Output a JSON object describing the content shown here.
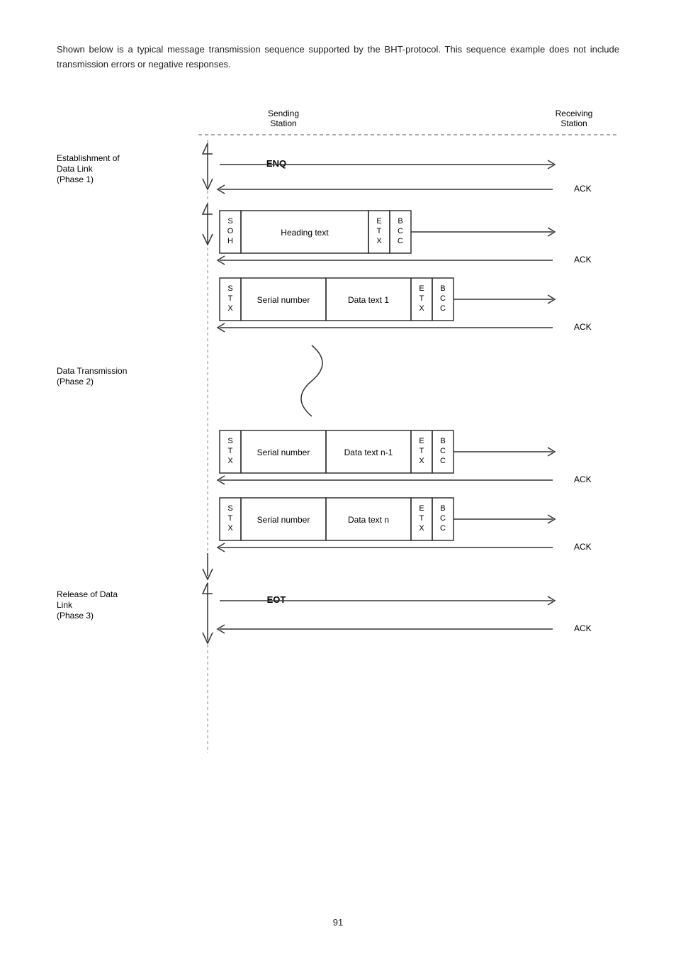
{
  "intro": {
    "text": "Shown below is a typical message transmission sequence supported by the BHT-protocol.  This sequence example does not include transmission errors or negative responses."
  },
  "diagram": {
    "sending_station": "Sending\nStation",
    "receiving_station": "Receiving\nStation",
    "phase1_label": "Establishment of\nData Link\n(Phase 1)",
    "phase2_label": "Data Transmission\n(Phase 2)",
    "phase3_label": "Release of Data\nLink\n(Phase 3)",
    "enq": "ENQ",
    "eot": "EOT",
    "ack": "ACK",
    "heading_text": "Heading text",
    "serial_number": "Serial number",
    "data_text_1": "Data text 1",
    "data_text_n1": "Data text n-1",
    "data_text_n": "Data text n",
    "soh": "S\nO\nH",
    "stx": "S\nT\nX",
    "etx_bcc_1": "E\nT\nX",
    "bcc_1": "B\nC\nC",
    "etx_bcc_2": "E\nT\nX",
    "bcc_2": "B\nC\nC"
  },
  "page_number": "91"
}
